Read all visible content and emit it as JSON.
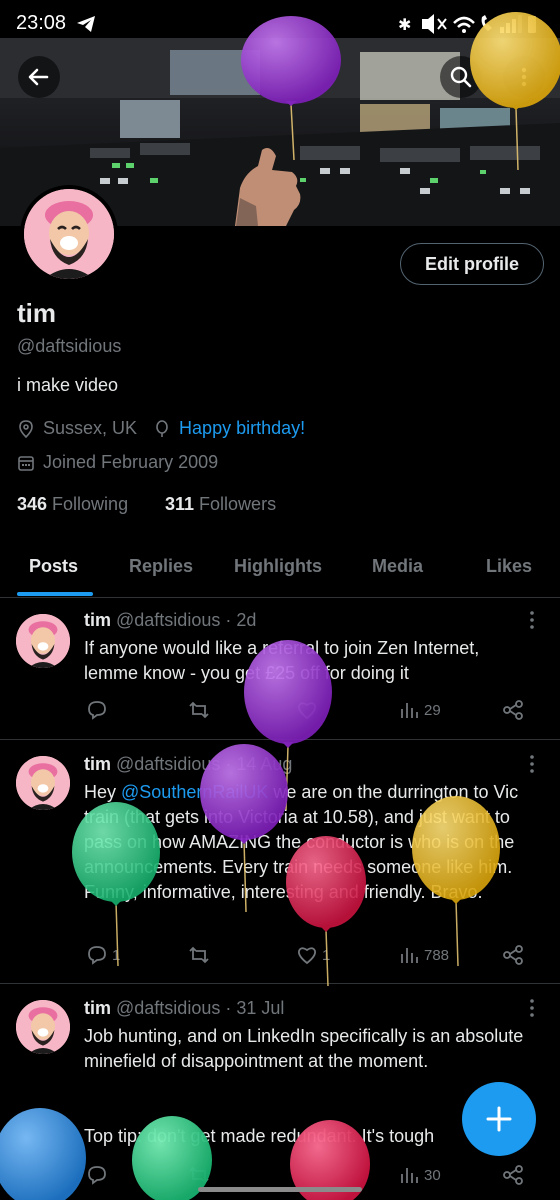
{
  "status_bar": {
    "time": "23:08"
  },
  "profile": {
    "name": "tim",
    "handle": "@daftsidious",
    "bio": "i make video",
    "location": "Sussex, UK",
    "birthday": "Happy birthday!",
    "joined": "Joined February 2009",
    "following_count": "346",
    "following_label": "Following",
    "followers_count": "311",
    "followers_label": "Followers",
    "edit_button": "Edit profile"
  },
  "tabs": [
    "Posts",
    "Replies",
    "Highlights",
    "Media",
    "Likes"
  ],
  "posts": [
    {
      "name": "tim",
      "meta": "@daftsidious · 2d",
      "text": "If anyone would like a referral to join Zen Internet, lemme know - you get £25 off for doing it",
      "views": "29"
    },
    {
      "name": "tim",
      "meta": "@daftsidious · 14 Aug",
      "text_before": "Hey ",
      "mention": "@SouthernRailUK",
      "text_after": " we are on the durrington to Vic train (that gets into Victoria at 10.58), and just want to pass on how AMAZING the conductor is who is on the announcements. Every train needs someone like him. Funny, informative, interesting and friendly. Bravo.",
      "replies": "1",
      "likes": "1",
      "views": "788"
    },
    {
      "name": "tim",
      "meta": "@daftsidious · 31 Jul",
      "text": "Job hunting, and on LinkedIn specifically is an absolute minefield of disappointment at the moment.",
      "text2": "Top tip: don't get made redundant. It's tough",
      "views": "30"
    }
  ],
  "colors": {
    "accent": "#1d9bf0",
    "background": "#000000",
    "muted": "#71767b",
    "balloon_purple": "#9b2fd6",
    "balloon_yellow": "#f2c21b",
    "balloon_green": "#2ed18a",
    "balloon_pink": "#e8245c",
    "balloon_blue": "#2f8fe0"
  }
}
